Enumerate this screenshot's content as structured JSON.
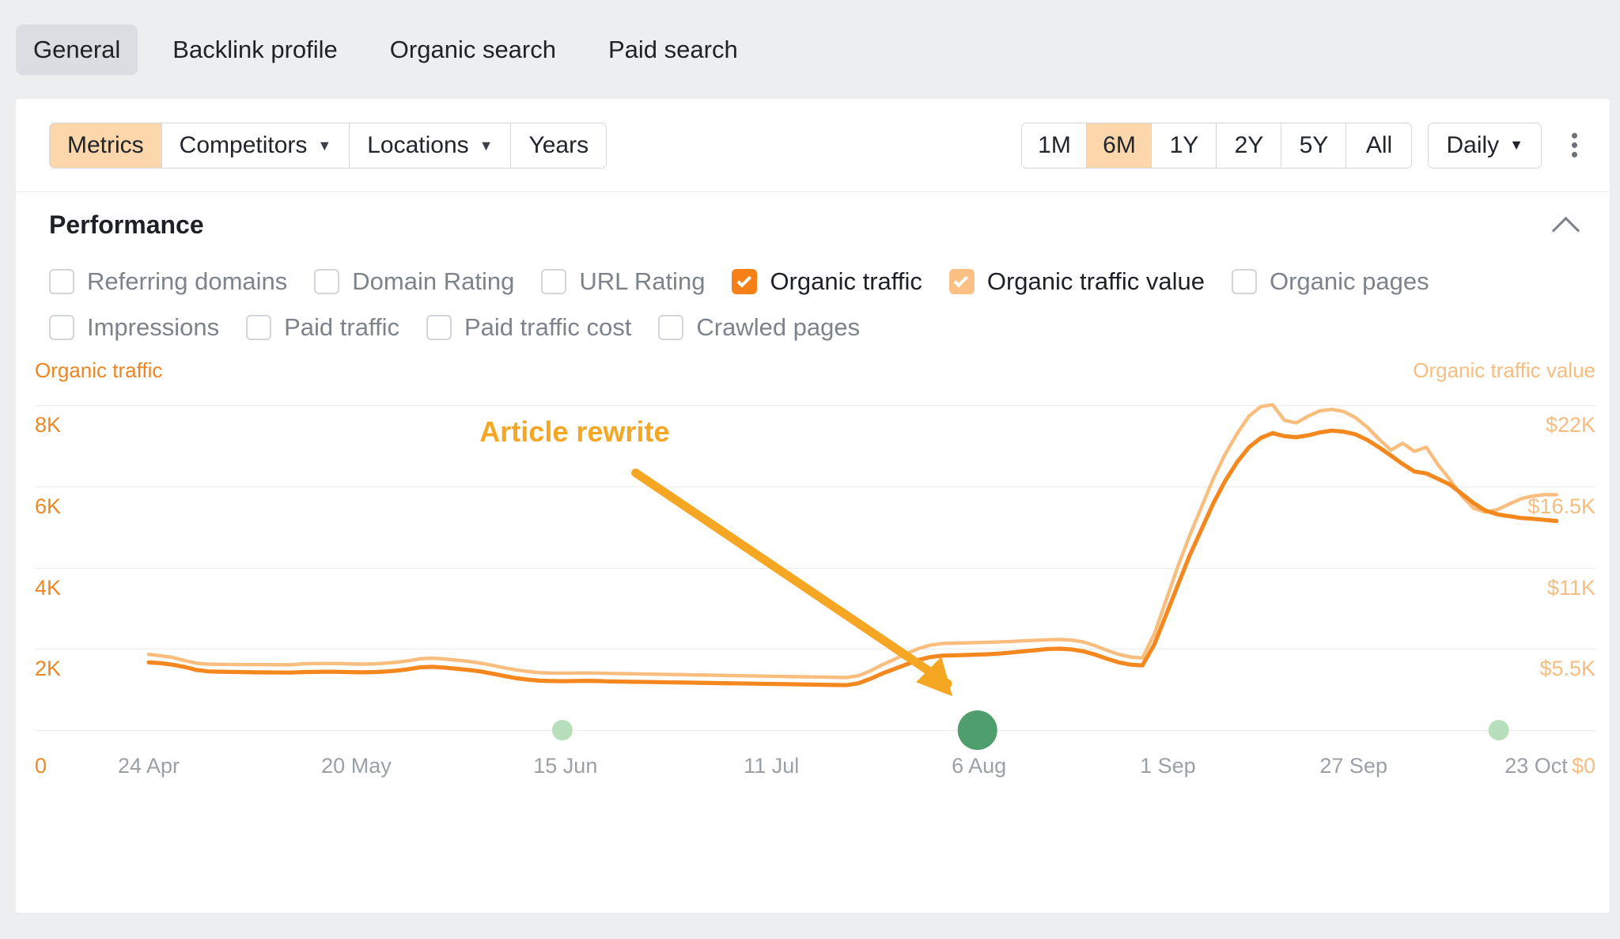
{
  "tabs": [
    {
      "label": "General",
      "active": true
    },
    {
      "label": "Backlink profile",
      "active": false
    },
    {
      "label": "Organic search",
      "active": false
    },
    {
      "label": "Paid search",
      "active": false
    }
  ],
  "toolbar": {
    "left_segments": [
      {
        "label": "Metrics",
        "selected": true,
        "caret": false
      },
      {
        "label": "Competitors",
        "selected": false,
        "caret": true
      },
      {
        "label": "Locations",
        "selected": false,
        "caret": true
      },
      {
        "label": "Years",
        "selected": false,
        "caret": false
      }
    ],
    "ranges": [
      {
        "label": "1M",
        "selected": false
      },
      {
        "label": "6M",
        "selected": true
      },
      {
        "label": "1Y",
        "selected": false
      },
      {
        "label": "2Y",
        "selected": false
      },
      {
        "label": "5Y",
        "selected": false
      },
      {
        "label": "All",
        "selected": false
      }
    ],
    "granularity": "Daily",
    "more_icon": "kebab-menu-icon"
  },
  "section": {
    "title": "Performance",
    "collapse_icon": "chevron-up-icon"
  },
  "metrics": [
    {
      "label": "Referring domains",
      "state": "unchecked"
    },
    {
      "label": "Domain Rating",
      "state": "unchecked"
    },
    {
      "label": "URL Rating",
      "state": "unchecked"
    },
    {
      "label": "Organic traffic",
      "state": "checked"
    },
    {
      "label": "Organic traffic value",
      "state": "checked-light"
    },
    {
      "label": "Organic pages",
      "state": "unchecked"
    },
    {
      "label": "Impressions",
      "state": "unchecked"
    },
    {
      "label": "Paid traffic",
      "state": "unchecked"
    },
    {
      "label": "Paid traffic cost",
      "state": "unchecked"
    },
    {
      "label": "Crawled pages",
      "state": "unchecked"
    }
  ],
  "colors": {
    "organic_traffic": "#f5871f",
    "organic_traffic_value": "#f9bd7e",
    "annotation": "#f5a623",
    "marker_major": "#4f9e6d",
    "marker_minor": "#b7dfbb",
    "selected_chip": "#fbd7ab"
  },
  "chart_data": {
    "type": "line",
    "title": "Performance",
    "annotations": [
      {
        "text": "Article rewrite",
        "points_to": "6 Aug",
        "arrow": true
      }
    ],
    "xlabel": "",
    "x_tick_labels": [
      "24 Apr",
      "20 May",
      "15 Jun",
      "11 Jul",
      "6 Aug",
      "1 Sep",
      "27 Sep",
      "23 Oct"
    ],
    "left_axis": {
      "name": "Organic traffic",
      "ticks": [
        "0",
        "2K",
        "4K",
        "6K",
        "8K"
      ],
      "range": [
        0,
        8800
      ],
      "color": "#f5871f"
    },
    "right_axis": {
      "name": "Organic traffic value",
      "ticks": [
        "$0",
        "$5.5K",
        "$11K",
        "$16.5K",
        "$22K"
      ],
      "range": [
        0,
        24200
      ],
      "color": "#f9bd7e"
    },
    "grid": true,
    "legend": "axis-titles",
    "markers": [
      {
        "x_label": "15 Jun",
        "size": "small",
        "color": "#b7dfbb"
      },
      {
        "x_label": "6 Aug",
        "size": "large",
        "color": "#4f9e6d"
      },
      {
        "x_label": "20 Oct",
        "size": "small",
        "color": "#b7dfbb"
      }
    ],
    "series": [
      {
        "name": "Organic traffic",
        "color": "#f5871f",
        "unit": "visits",
        "values": [
          1820,
          1800,
          1760,
          1700,
          1620,
          1580,
          1570,
          1565,
          1560,
          1555,
          1552,
          1550,
          1548,
          1560,
          1565,
          1570,
          1568,
          1560,
          1555,
          1560,
          1575,
          1600,
          1640,
          1690,
          1700,
          1680,
          1650,
          1620,
          1580,
          1520,
          1460,
          1400,
          1360,
          1330,
          1320,
          1315,
          1320,
          1325,
          1320,
          1310,
          1305,
          1300,
          1295,
          1290,
          1285,
          1280,
          1275,
          1270,
          1265,
          1260,
          1255,
          1250,
          1245,
          1240,
          1235,
          1230,
          1225,
          1220,
          1215,
          1210,
          1260,
          1380,
          1520,
          1640,
          1760,
          1880,
          1960,
          2000,
          2010,
          2020,
          2030,
          2040,
          2060,
          2090,
          2120,
          2150,
          2180,
          2190,
          2170,
          2120,
          2030,
          1920,
          1820,
          1760,
          1740,
          2300,
          3100,
          3900,
          4700,
          5400,
          6100,
          6700,
          7200,
          7600,
          7850,
          7980,
          7900,
          7870,
          7920,
          8000,
          8050,
          8020,
          7950,
          7800,
          7600,
          7380,
          7150,
          6950,
          6900,
          6750,
          6600,
          6350,
          6100,
          5900,
          5800,
          5750,
          5700,
          5680,
          5650,
          5620
        ]
      },
      {
        "name": "Organic traffic value",
        "color": "#f9bd7e",
        "unit": "usd",
        "values": [
          5600,
          5500,
          5380,
          5150,
          4950,
          4880,
          4860,
          4850,
          4845,
          4840,
          4838,
          4835,
          4832,
          4900,
          4920,
          4930,
          4925,
          4900,
          4880,
          4895,
          4950,
          5020,
          5130,
          5280,
          5320,
          5260,
          5180,
          5080,
          4960,
          4800,
          4620,
          4460,
          4340,
          4250,
          4220,
          4210,
          4220,
          4230,
          4215,
          4190,
          4175,
          4160,
          4145,
          4130,
          4115,
          4100,
          4085,
          4070,
          4055,
          4040,
          4025,
          4010,
          3995,
          3980,
          3965,
          3950,
          3935,
          3920,
          3905,
          3890,
          4020,
          4380,
          4830,
          5220,
          5620,
          6010,
          6270,
          6400,
          6430,
          6450,
          6470,
          6490,
          6520,
          6560,
          6600,
          6640,
          6680,
          6700,
          6660,
          6520,
          6240,
          5900,
          5600,
          5400,
          5340,
          7100,
          9600,
          12100,
          14400,
          16500,
          18600,
          20400,
          21900,
          23200,
          23900,
          24050,
          22900,
          22700,
          23200,
          23600,
          23700,
          23550,
          23100,
          22400,
          21500,
          20700,
          21200,
          20600,
          20900,
          19600,
          18500,
          17300,
          16400,
          16100,
          16300,
          16700,
          17100,
          17300,
          17400,
          17400
        ]
      }
    ]
  }
}
